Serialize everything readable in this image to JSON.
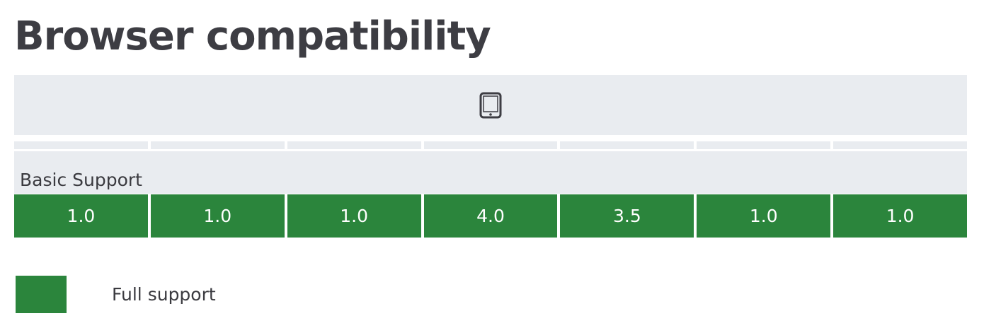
{
  "page": {
    "title": "Browser compatibility"
  },
  "table": {
    "platform_icon": "tablet-icon",
    "browser_count": 7,
    "feature_label": "Basic Support",
    "support_versions": [
      "1.0",
      "1.0",
      "1.0",
      "4.0",
      "3.5",
      "1.0",
      "1.0"
    ],
    "support_status": "full"
  },
  "legend": {
    "items": [
      {
        "label": "Full support",
        "color": "#2b853c"
      }
    ]
  },
  "colors": {
    "full_support": "#2b853c",
    "header_bg": "#e9ecf0",
    "title_text": "#3d3d43"
  }
}
